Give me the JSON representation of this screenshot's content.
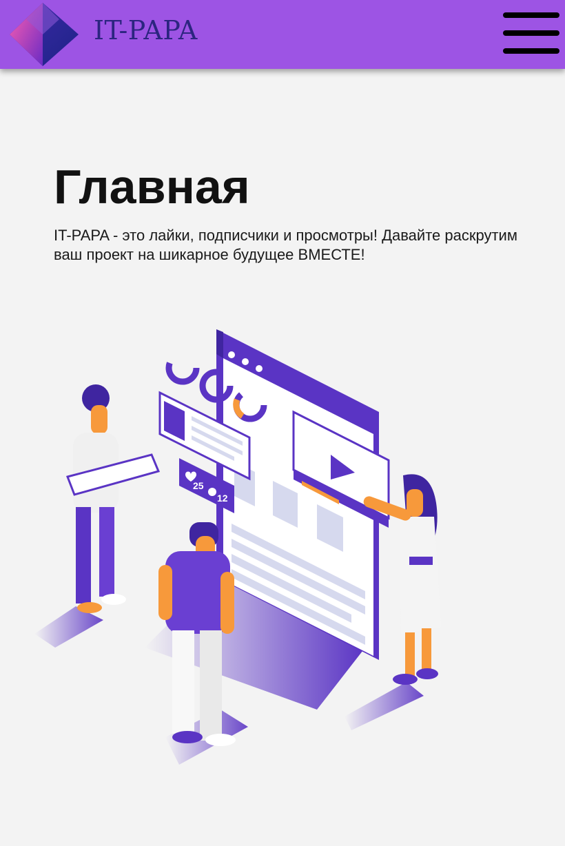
{
  "header": {
    "brand": "IT-PAPA",
    "menu_icon": "hamburger-menu-icon",
    "logo_icon": "gem-cube-logo-icon",
    "colors": {
      "bar": "#9d54e4",
      "brand_text": "#2c2580"
    }
  },
  "hero": {
    "title": "Главная",
    "description": "IT-PAPA - это лайки, подписчики и просмотры! Давайте раскрутим ваш проект на шикарное будущее ВМЕСТЕ!",
    "illustration": {
      "likes_count": "25",
      "comments_count": "12",
      "like_icon": "heart-icon",
      "comment_icon": "comment-bubble-icon",
      "play_icon": "play-icon",
      "colors": {
        "primary": "#5a34c4",
        "accent": "#f7993b"
      }
    }
  }
}
